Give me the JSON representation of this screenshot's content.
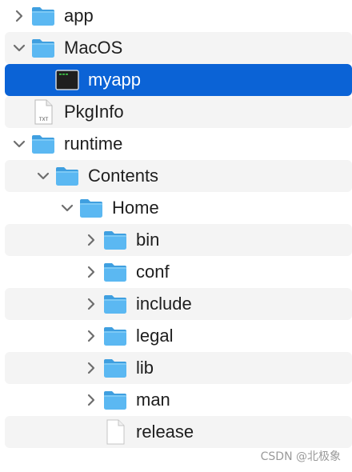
{
  "finder_tree": {
    "rows": [
      {
        "label": "app",
        "icon": "folder-icon",
        "chevron": "collapsed"
      },
      {
        "label": "MacOS",
        "icon": "folder-icon",
        "chevron": "expanded"
      },
      {
        "label": "myapp",
        "icon": "terminal-executable-icon",
        "chevron": "none",
        "selected": true
      },
      {
        "label": "PkgInfo",
        "icon": "text-document-icon",
        "chevron": "none",
        "icon_text": "TXT"
      },
      {
        "label": "runtime",
        "icon": "folder-icon",
        "chevron": "expanded"
      },
      {
        "label": "Contents",
        "icon": "folder-icon",
        "chevron": "expanded"
      },
      {
        "label": "Home",
        "icon": "folder-icon",
        "chevron": "expanded"
      },
      {
        "label": "bin",
        "icon": "folder-icon",
        "chevron": "collapsed"
      },
      {
        "label": "conf",
        "icon": "folder-icon",
        "chevron": "collapsed"
      },
      {
        "label": "include",
        "icon": "folder-icon",
        "chevron": "collapsed"
      },
      {
        "label": "legal",
        "icon": "folder-icon",
        "chevron": "collapsed"
      },
      {
        "label": "lib",
        "icon": "folder-icon",
        "chevron": "collapsed"
      },
      {
        "label": "man",
        "icon": "folder-icon",
        "chevron": "collapsed"
      },
      {
        "label": "release",
        "icon": "blank-document-icon",
        "chevron": "none"
      }
    ]
  },
  "watermark": "CSDN @北极象",
  "colors": {
    "selection": "#0b63d6",
    "stripe": "#f4f4f4",
    "folder_front": "#5bb8f2",
    "folder_back": "#3f9fe0"
  }
}
